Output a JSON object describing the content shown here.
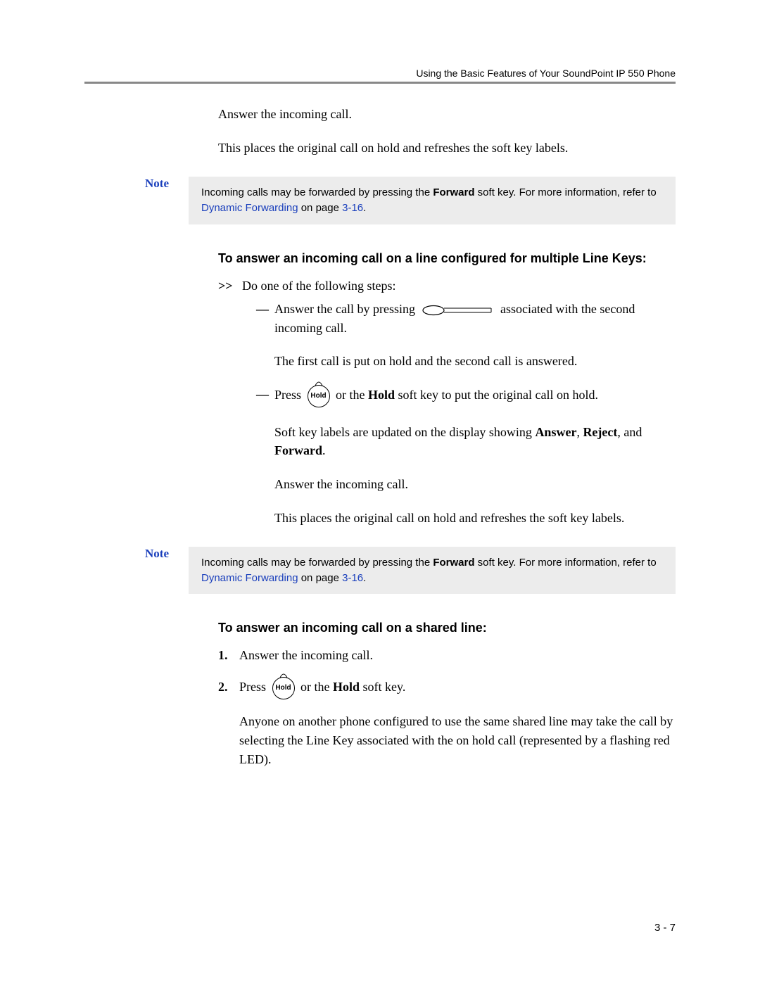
{
  "header": {
    "running": "Using the Basic Features of Your SoundPoint IP 550 Phone"
  },
  "intro": {
    "p1": "Answer the incoming call.",
    "p2": "This places the original call on hold and refreshes the soft key labels."
  },
  "note1": {
    "label": "Note",
    "text_a": "Incoming calls may be forwarded by pressing the ",
    "forward": "Forward",
    "text_b": " soft key. For more information, refer to ",
    "link": "Dynamic Forwarding",
    "text_c": " on page ",
    "pageref": "3-16",
    "text_d": "."
  },
  "sectionA": {
    "heading": "To answer an incoming call on a line configured for multiple Line Keys:",
    "lead_marker": ">>",
    "lead_text": "Do one of the following steps:",
    "bullet1_a": "Answer the call by pressing ",
    "bullet1_b": " associated with the second incoming call.",
    "bullet1_follow": "The first call is put on hold and the second call is answered.",
    "bullet2_a": "Press ",
    "hold_label": "Hold",
    "bullet2_b": " or the ",
    "bullet2_hold_word": "Hold",
    "bullet2_c": " soft key to put the original call on hold.",
    "bullet2_follow_a": "Soft key labels are updated on the display showing ",
    "answer": "Answer",
    "sep1": ", ",
    "reject": "Reject",
    "sep2": ", and ",
    "forward": "Forward",
    "bullet2_follow_end": ".",
    "p3": "Answer the incoming call.",
    "p4": "This places the original call on hold and refreshes the soft key labels."
  },
  "note2": {
    "label": "Note",
    "text_a": "Incoming calls may be forwarded by pressing the ",
    "forward": "Forward",
    "text_b": " soft key. For more information, refer to ",
    "link": "Dynamic Forwarding",
    "text_c": " on page ",
    "pageref": "3-16",
    "text_d": "."
  },
  "sectionB": {
    "heading": "To answer an incoming call on a shared line:",
    "item1_num": "1.",
    "item1_text": "Answer the incoming call.",
    "item2_num": "2.",
    "item2_a": "Press ",
    "hold_label": "Hold",
    "item2_b": " or the ",
    "item2_hold_word": "Hold",
    "item2_c": " soft key.",
    "item2_follow": "Anyone on another phone configured to use the same shared line may take the call by selecting the Line Key associated with the on hold call (represented by a flashing red LED)."
  },
  "footer": {
    "page": "3 - 7"
  }
}
